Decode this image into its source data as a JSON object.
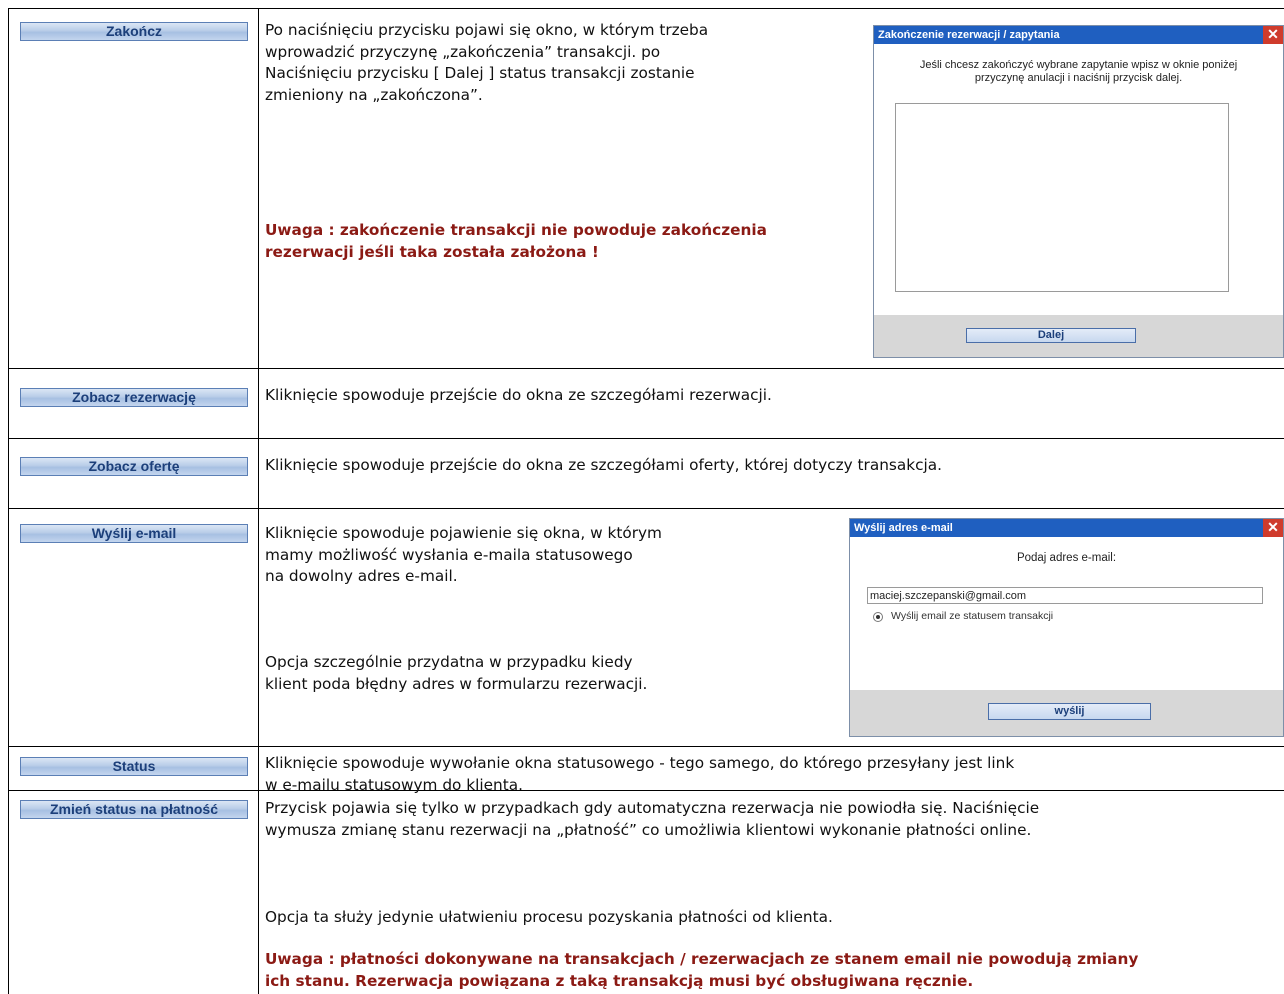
{
  "rows": [
    {
      "button": "Zakończ",
      "text": "Po naciśnięciu przycisku pojawi się okno, w którym trzeba\nwprowadzić przyczynę „zakończenia” transakcji. po\nNaciśnięciu przycisku [ Dalej ] status transakcji zostanie\nzmieniony na „zakończona”.",
      "warning": "Uwaga : zakończenie transakcji nie powoduje zakończenia\nrezerwacji jeśli taka została założona !"
    },
    {
      "button": "Zobacz rezerwację",
      "text": "Kliknięcie spowoduje przejście do okna ze szczegółami rezerwacji."
    },
    {
      "button": "Zobacz ofertę",
      "text": "Kliknięcie spowoduje przejście do okna ze szczegółami oferty, której dotyczy transakcja."
    },
    {
      "button": "Wyślij e-mail",
      "text": "Kliknięcie spowoduje pojawienie się okna, w którym\nmamy możliwość wysłania e-maila statusowego\nna dowolny adres e-mail.",
      "text2": "Opcja szczególnie przydatna w przypadku kiedy\nklient poda błędny adres w formularzu rezerwacji."
    },
    {
      "button": "Status",
      "text": "Kliknięcie spowoduje wywołanie okna statusowego - tego samego, do którego przesyłany jest link\nw e-mailu statusowym do klienta."
    },
    {
      "button": "Zmień status na płatność",
      "text": "Przycisk pojawia się tylko w przypadkach gdy automatyczna rezerwacja nie powiodła się. Naciśnięcie\nwymusza zmianę stanu rezerwacji na „płatność” co umożliwia klientowi wykonanie płatności online.",
      "text2": "Opcja ta służy jedynie ułatwieniu procesu pozyskania płatności od klienta.",
      "warning": "Uwaga : płatności dokonywane na transakcjach / rezerwacjach ze stanem email nie powodują zmiany\nich stanu. Rezerwacja powiązana z taką transakcją musi być obsługiwana ręcznie."
    }
  ],
  "dialog_end": {
    "title": "Zakończenie rezerwacji / zapytania",
    "close": "✕",
    "prompt": "Jeśli chcesz zakończyć wybrane zapytanie wpisz w oknie poniżej\nprzyczynę anulacji i naciśnij przycisk dalej.",
    "textarea_value": "",
    "button": "Dalej"
  },
  "dialog_email": {
    "title": "Wyślij adres e-mail",
    "close": "✕",
    "prompt": "Podaj adres e-mail:",
    "email_value": "maciej.szczepanski@gmail.com",
    "radio_label": "Wyślij email ze statusem transakcji",
    "button": "wyślij"
  },
  "colors": {
    "warning": "#8b1a14",
    "titlebar": "#1f5fc0",
    "button_text": "#1c3f7a"
  }
}
